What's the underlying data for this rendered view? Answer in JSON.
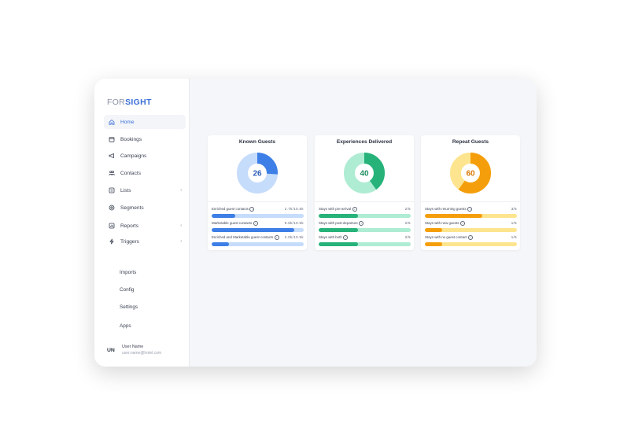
{
  "brand": {
    "part1": "FOR",
    "part2": "SIGHT"
  },
  "nav": [
    {
      "label": "Home",
      "icon": "home-icon",
      "active": true
    },
    {
      "label": "Bookings",
      "icon": "calendar-icon"
    },
    {
      "label": "Campaigns",
      "icon": "megaphone-icon"
    },
    {
      "label": "Contacts",
      "icon": "people-icon"
    },
    {
      "label": "Lists",
      "icon": "list-icon",
      "chevron": "‹"
    },
    {
      "label": "Segments",
      "icon": "segments-icon"
    },
    {
      "label": "Reports",
      "icon": "reports-icon",
      "chevron": "‹"
    },
    {
      "label": "Triggers",
      "icon": "triggers-icon",
      "chevron": "‹"
    }
  ],
  "secondary_nav": [
    "Imports",
    "Config",
    "Settings",
    "Apps"
  ],
  "user": {
    "initials": "UN",
    "name": "User Name",
    "email": "user.name@hotel.com"
  },
  "cards": [
    {
      "title": "Known Guests",
      "value": "26",
      "percent": 26,
      "colors": {
        "main": "#3d7fe6",
        "light": "#c6dcfb",
        "text": "#2c5fb8"
      },
      "metrics": [
        {
          "label": "Enriched guest contacts",
          "value": "2.7k/10.5k",
          "fraction": 0.26
        },
        {
          "label": "Marketable guest contacts",
          "value": "9.5k/10.5k",
          "fraction": 0.9
        },
        {
          "label": "Enriched and Marketable guest contacts",
          "value": "2.0k/10.5k",
          "fraction": 0.19
        }
      ]
    },
    {
      "title": "Experiences Delivered",
      "value": "40",
      "percent": 40,
      "colors": {
        "main": "#27b27a",
        "light": "#aeecd3",
        "text": "#1f8f62"
      },
      "metrics": [
        {
          "label": "Stays with pre-arrival",
          "value": "2/5",
          "fraction": 0.43
        },
        {
          "label": "Stays with post-departure",
          "value": "2/5",
          "fraction": 0.43
        },
        {
          "label": "Stays with both",
          "value": "2/5",
          "fraction": 0.43
        }
      ]
    },
    {
      "title": "Repeat Guests",
      "value": "60",
      "percent": 60,
      "colors": {
        "main": "#f59e0b",
        "light": "#fde58f",
        "text": "#d97706"
      },
      "metrics": [
        {
          "label": "Stays with returning guests",
          "value": "3/5",
          "fraction": 0.62
        },
        {
          "label": "Stays with new guests",
          "value": "1/5",
          "fraction": 0.19
        },
        {
          "label": "Stays with no guest contact",
          "value": "1/5",
          "fraction": 0.19
        }
      ]
    }
  ]
}
